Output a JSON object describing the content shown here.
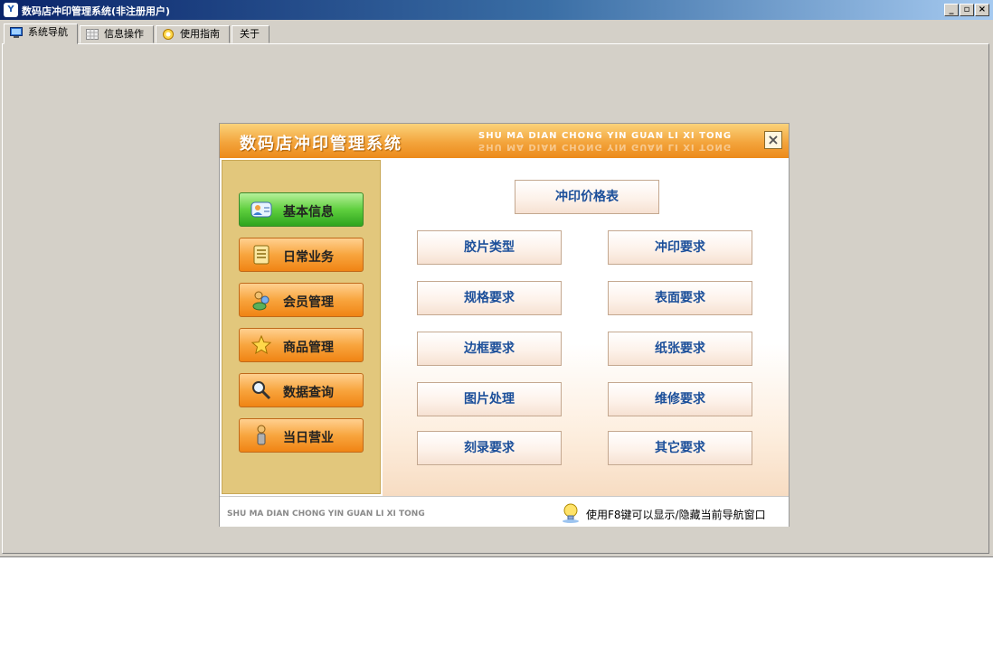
{
  "window": {
    "title": "数码店冲印管理系统(非注册用户)",
    "controls": {
      "minimize": "_",
      "restore": "▫",
      "close": "×"
    }
  },
  "tabs": [
    {
      "label": "系统导航",
      "icon": "monitor-icon",
      "active": true
    },
    {
      "label": "信息操作",
      "icon": "grid-icon",
      "active": false
    },
    {
      "label": "使用指南",
      "icon": "help-icon",
      "active": false
    },
    {
      "label": "关于",
      "icon": "",
      "active": false
    }
  ],
  "nav_window": {
    "title": "数码店冲印管理系统",
    "subtitle": "SHU MA DIAN CHONG YIN GUAN LI XI TONG",
    "close_label": "×",
    "sidebar": [
      {
        "label": "基本信息",
        "icon": "user-card-icon",
        "style": "green"
      },
      {
        "label": "日常业务",
        "icon": "document-icon",
        "style": "orange"
      },
      {
        "label": "会员管理",
        "icon": "members-icon",
        "style": "orange"
      },
      {
        "label": "商品管理",
        "icon": "star-icon",
        "style": "orange"
      },
      {
        "label": "数据查询",
        "icon": "magnifier-icon",
        "style": "orange"
      },
      {
        "label": "当日营业",
        "icon": "person-icon",
        "style": "orange"
      }
    ],
    "price_button": "冲印价格表",
    "actions": [
      {
        "left": "胶片类型",
        "right": "冲印要求"
      },
      {
        "left": "规格要求",
        "right": "表面要求"
      },
      {
        "left": "边框要求",
        "right": "纸张要求"
      },
      {
        "left": "图片处理",
        "right": "维修要求"
      },
      {
        "left": "刻录要求",
        "right": "其它要求"
      }
    ],
    "footer": {
      "text": "SHU MA DIAN CHONG YIN GUAN LI XI TONG",
      "tip": "使用F8键可以显示/隐藏当前导航窗口",
      "tip_icon": "lightbulb-icon"
    }
  },
  "colors": {
    "accent_orange": "#f3a43c",
    "action_text": "#1b4f9a",
    "green_button": "#5fcf3e"
  }
}
